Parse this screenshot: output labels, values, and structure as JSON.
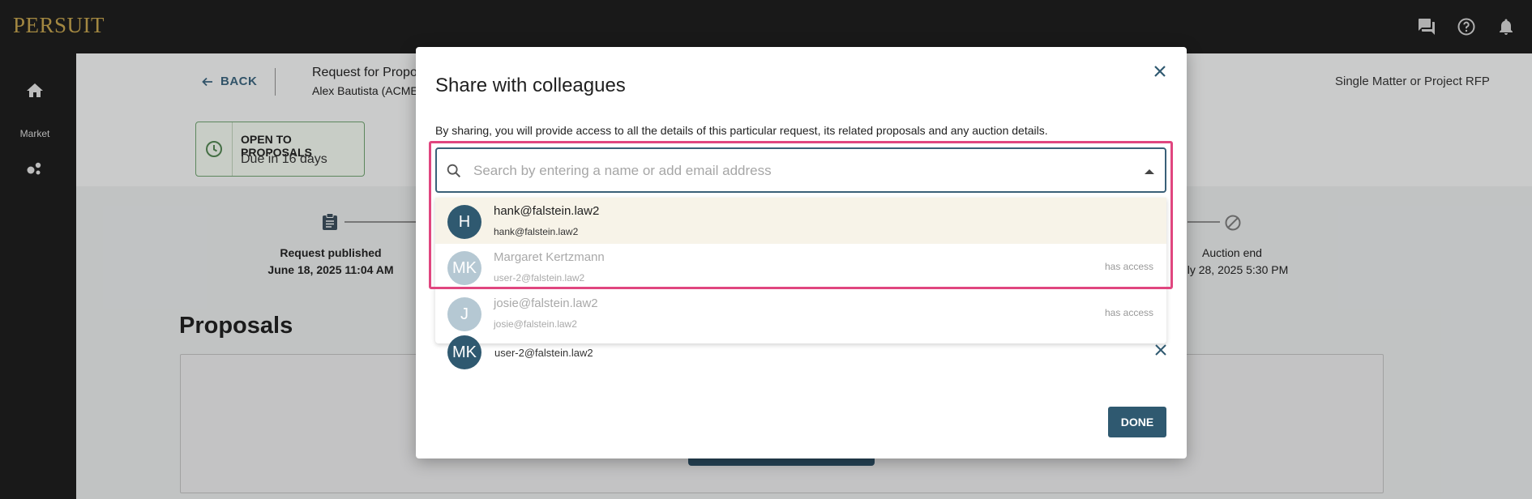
{
  "app": {
    "logo": "PERSUIT"
  },
  "topbar": {
    "icons": [
      "chat-icon",
      "help-icon",
      "bell-icon"
    ]
  },
  "sidebar": {
    "home_icon": "home-icon",
    "market_label": "Market",
    "market_icon": "market-icon"
  },
  "page": {
    "back_label": "BACK",
    "request_title": "Request for Propo",
    "request_owner": "Alex Bautista (ACME",
    "rfp_type": "Single Matter or Project RFP",
    "status": {
      "title": "OPEN TO PROPOSALS",
      "due": "Due in 16 days"
    },
    "timeline": {
      "published_label": "Request published",
      "published_date": "June 18, 2025 11:04 AM",
      "auction_end_label": "Auction end",
      "auction_end_date": "ly 28, 2025 5:30 PM"
    },
    "proposals_heading": "Proposals"
  },
  "modal": {
    "title": "Share with colleagues",
    "description": "By sharing, you will provide access to all the details of this particular request, its related proposals and any auction details.",
    "search": {
      "placeholder": "Search by entering a name or add email address",
      "value": ""
    },
    "options": [
      {
        "initials": "H",
        "name": "hank@falstein.law2",
        "email": "hank@falstein.law2",
        "access": "",
        "color": "#2f5970"
      },
      {
        "initials": "MK",
        "name": "Margaret Kertzmann",
        "email": "user-2@falstein.law2",
        "access": "has access",
        "color": "#b5c8d3"
      },
      {
        "initials": "J",
        "name": "josie@falstein.law2",
        "email": "josie@falstein.law2",
        "access": "has access",
        "color": "#b5c8d3"
      }
    ],
    "shared": {
      "initials": "MK",
      "email": "user-2@falstein.law2"
    },
    "done_label": "DONE"
  },
  "colors": {
    "accent": "#2f5970",
    "highlight": "#e0467f",
    "logo": "#b99a4a"
  }
}
